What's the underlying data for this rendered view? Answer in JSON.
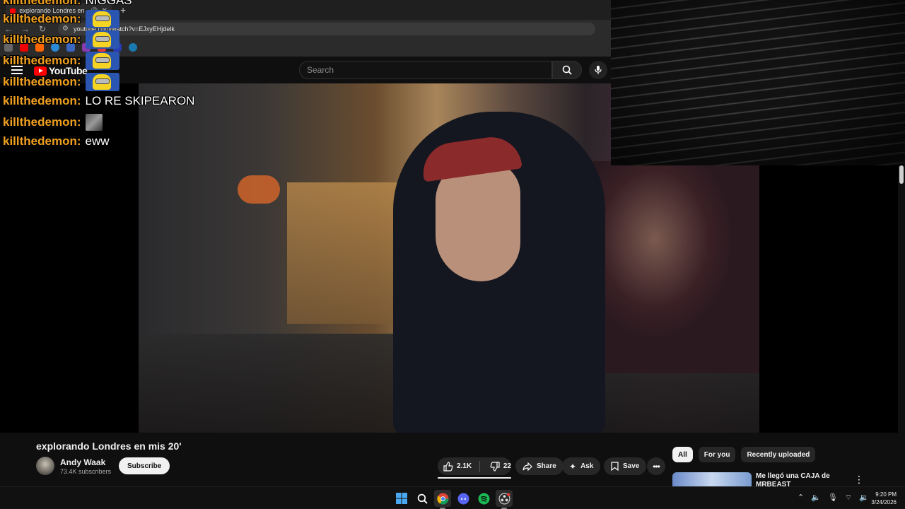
{
  "browser": {
    "tab_title": "explorando Londres en mis 20'",
    "url": "youtube.com/watch?v=EJxyEHjdelk"
  },
  "youtube": {
    "logo_text": "YouTube",
    "search_placeholder": "Search"
  },
  "chat": [
    {
      "user": "killthedemon:",
      "message": "NIGGAS",
      "type": "text"
    },
    {
      "user": "killthedemon:",
      "message": "",
      "type": "emote"
    },
    {
      "user": "killthedemon:",
      "message": "",
      "type": "emote"
    },
    {
      "user": "killthedemon:",
      "message": "",
      "type": "emote"
    },
    {
      "user": "killthedemon:",
      "message": "",
      "type": "emote"
    },
    {
      "user": "killthedemon:",
      "message": "LO RE SKIPEARON",
      "type": "text"
    },
    {
      "user": "killthedemon:",
      "message": "",
      "type": "emote-small"
    },
    {
      "user": "killthedemon:",
      "message": "eww",
      "type": "text"
    }
  ],
  "video": {
    "title": "explorando Londres en mis 20'",
    "channel": "Andy Waak",
    "subscribers": "73.4K subscribers",
    "subscribe_label": "Subscribe",
    "likes": "2.1K",
    "dislikes": "22",
    "share_label": "Share",
    "ask_label": "Ask",
    "save_label": "Save"
  },
  "recommendations": {
    "chips": [
      "All",
      "For you",
      "Recently uploaded"
    ],
    "active_chip": "All",
    "first_title": "Me llegó una CAJA de MRBEAST"
  },
  "taskbar": {
    "apps": [
      "windows-start",
      "search",
      "chrome",
      "discord",
      "spotify",
      "obs"
    ],
    "time": "9:20 PM",
    "date": "3/24/2026"
  },
  "colors": {
    "chat_username": "#f0a020",
    "yt_red": "#ff0000",
    "background": "#0f0f0f"
  }
}
